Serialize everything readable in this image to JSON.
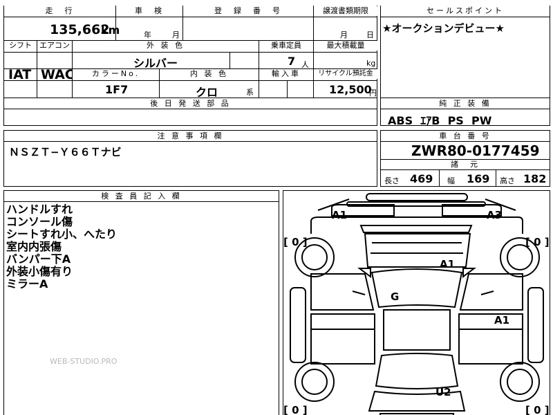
{
  "row1": {
    "mileage_label": "走　行",
    "mileage_value": "135,662",
    "mileage_unit": "km",
    "inspection_label": "車　検",
    "inspection_year_unit": "年",
    "inspection_month_unit": "月",
    "registration_label": "登　録　番　号",
    "transfer_label": "譲渡書類期限",
    "transfer_month_unit": "月",
    "transfer_day_unit": "日"
  },
  "row2": {
    "shift_label": "シフト",
    "shift_value": "IAT",
    "ac_label": "エアコン",
    "ac_value": "WAC",
    "exterior_color_label": "外 装 色",
    "exterior_color_value": "シルバー",
    "capacity_label": "乗車定員",
    "capacity_value": "7",
    "capacity_unit": "人",
    "max_load_label": "最大積載量",
    "max_load_unit": "kg",
    "color_no_label": "カラーNo.",
    "color_no_value": "1F7",
    "interior_color_label": "内 装 色",
    "interior_color_value": "クロ",
    "interior_color_unit": "系",
    "import_label": "輸入車",
    "recycle_label": "リサイクル預託金",
    "recycle_value": "12,500",
    "recycle_unit": "円"
  },
  "post_delivery": {
    "label": "後 日 発 送 部 品"
  },
  "sales_point": {
    "label": "セールスポイント",
    "text": "★オークションデビュー★"
  },
  "equipment": {
    "label": "純 正 装 備",
    "items": "ABS  ｴｱB  PS  PW"
  },
  "caution": {
    "label": "注 意 事 項 欄",
    "text": "ＮＳＺＴ−Ｙ６６Ｔナビ"
  },
  "chassis": {
    "label": "車 台 番 号",
    "value": "ZWR80-0177459",
    "spec_label": "諸　元"
  },
  "dimensions": {
    "length_label": "長さ",
    "length_value": "469",
    "width_label": "幅",
    "width_value": "169",
    "height_label": "高さ",
    "height_value": "182"
  },
  "inspector": {
    "label": "検 査 員 記 入 欄",
    "lines": [
      "ハンドルすれ",
      "コンソール傷",
      "シートすれ小、へたり",
      "室内内張傷",
      "バンパー下A",
      "外装小傷有り",
      "ミラーA"
    ]
  },
  "diagram": {
    "marks": [
      "A1",
      "A3",
      "A1",
      "G",
      "A1",
      "U2"
    ],
    "tire_counts": [
      "[ 0 ]",
      "[ 0 ]",
      "[ 0 ]",
      "[ 0 ]"
    ]
  },
  "watermark": "WEB-STUDIO.PRO"
}
